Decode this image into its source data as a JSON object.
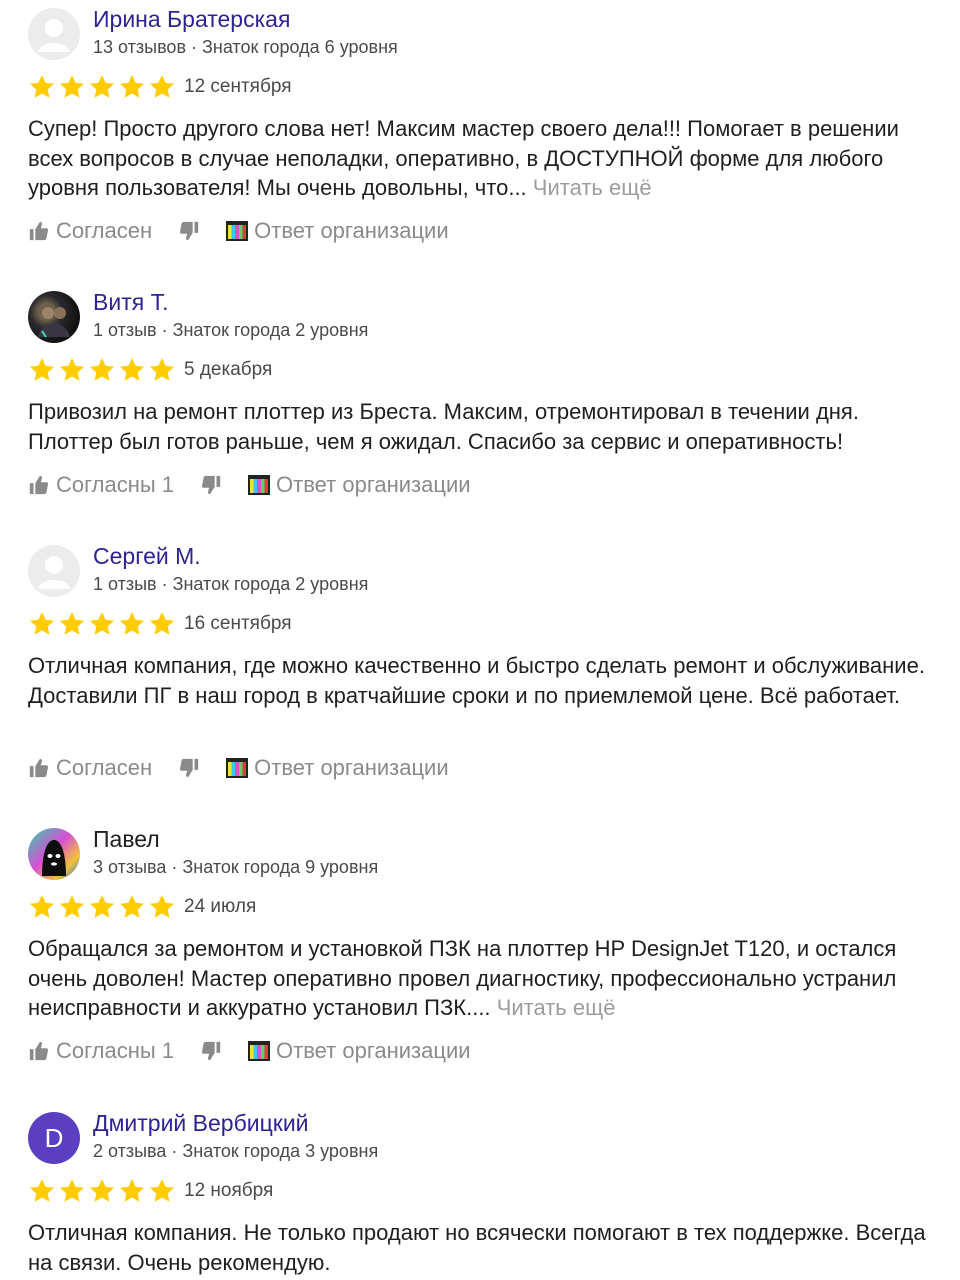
{
  "reviews": [
    {
      "name": "Ирина Братерская",
      "meta": "13 отзывов · Знаток города 6 уровня",
      "date": "12 сентября",
      "text": "Супер! Просто другого слова нет! Максим мастер своего дела!!! Помогает в решении всех вопросов в случае неполадки, оперативно, в ДОСТУПНОЙ форме для любого уровня пользователя! Мы очень довольны, что...",
      "read_more": "Читать ещё",
      "agree": "Согласен",
      "org_reply": "Ответ организации",
      "avatar": "placeholder-avatar-icon",
      "rating": 5
    },
    {
      "name": "Витя Т.",
      "meta": "1 отзыв · Знаток города 2 уровня",
      "date": "5 декабря",
      "text": "Привозил на ремонт плоттер из Бреста. Максим, отремонтировал в течении дня. Плоттер был готов раньше, чем я ожидал. Спасибо за сервис и оперативность!",
      "read_more": "",
      "agree": "Согласны 1",
      "org_reply": "Ответ организации",
      "avatar": "photo",
      "rating": 5
    },
    {
      "name": "Сергей М.",
      "meta": "1 отзыв · Знаток города 2 уровня",
      "date": "16 сентября",
      "text": "Отличная компания, где можно качественно и быстро сделать ремонт и обслуживание. Доставили ПГ в наш город в кратчайшие сроки и по приемлемой цене. Всё работает.",
      "read_more": "",
      "agree": "Согласен",
      "org_reply": "Ответ организации",
      "avatar": "placeholder-avatar-icon",
      "rating": 5
    },
    {
      "name": "Павел",
      "meta": "3 отзыва · Знаток города 9 уровня",
      "date": "24 июля",
      "text": "Обращался за ремонтом и установкой ПЗК на плоттер HP DesignJet T120, и остался очень доволен! Мастер оперативно провел диагностику, профессионально устранил неисправности и аккуратно установил ПЗК....",
      "read_more": "Читать ещё",
      "agree": "Согласны 1",
      "org_reply": "Ответ организации",
      "avatar": "photo",
      "rating": 5
    },
    {
      "name": "Дмитрий Вербицкий",
      "meta": "2 отзыва · Знаток города 3 уровня",
      "date": "12 ноября",
      "text": "Отличная компания. Не только продают но всячески помогают в тех поддержке. Всегда на связи. Очень рекомендую.",
      "read_more": "",
      "avatar_letter": "D",
      "avatar": "letter",
      "rating": 5
    }
  ],
  "colors": {
    "name_link": "#2d2494",
    "star": "#fc0",
    "muted": "#8a8a8a",
    "letter_avatar": "#5b3fc1"
  }
}
